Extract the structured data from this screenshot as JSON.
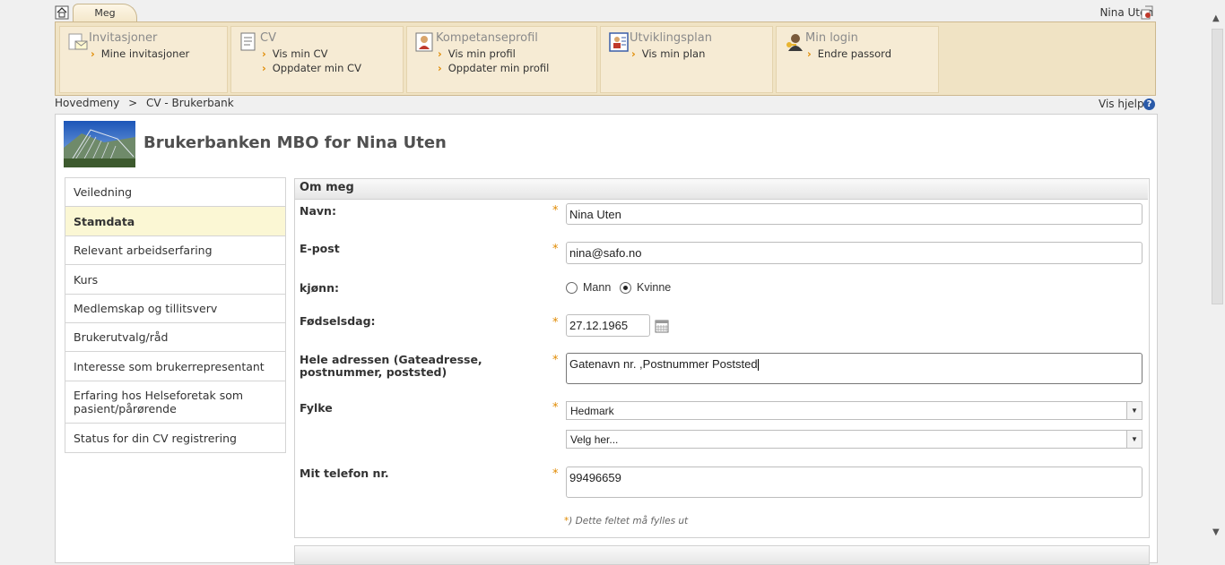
{
  "top": {
    "tab_label": "Meg",
    "user_name": "Nina Uten"
  },
  "menu": [
    {
      "title": "Invitasjoner",
      "links": [
        "Mine invitasjoner"
      ]
    },
    {
      "title": "CV",
      "links": [
        "Vis min CV",
        "Oppdater min CV"
      ]
    },
    {
      "title": "Kompetanseprofil",
      "links": [
        "Vis min profil",
        "Oppdater min profil"
      ]
    },
    {
      "title": "Utviklingsplan",
      "links": [
        "Vis min plan"
      ]
    },
    {
      "title": "Min login",
      "links": [
        "Endre passord"
      ]
    }
  ],
  "breadcrumb": {
    "home": "Hovedmeny",
    "sep": ">",
    "current": "CV - Brukerbank"
  },
  "help": {
    "label": "Vis hjelp",
    "icon": "?"
  },
  "page_title": "Brukerbanken MBO for Nina Uten",
  "nav": [
    "Veiledning",
    "Stamdata",
    "Relevant arbeidserfaring",
    "Kurs",
    "Medlemskap og tillitsverv",
    "Brukerutvalg/råd",
    "Interesse som brukerrepresentant",
    "Erfaring hos Helseforetak som pasient/pårørende",
    "Status for din CV registrering"
  ],
  "nav_active_index": 1,
  "form": {
    "title": "Om meg",
    "name_label": "Navn:",
    "name_value": "Nina Uten",
    "email_label": "E-post",
    "email_value": "nina@safo.no",
    "gender_label": "kjønn:",
    "gender_options": [
      "Mann",
      "Kvinne"
    ],
    "gender_selected": "Kvinne",
    "birthday_label": "Fødselsdag:",
    "birthday_value": "27.12.1965",
    "address_label": "Hele adressen (Gateadresse, postnummer, poststed)",
    "address_value": "Gatenavn nr. ,Postnummer Poststed",
    "county_label": "Fylke",
    "county_value": "Hedmark",
    "municipality_placeholder": "Velg her...",
    "phone_label": "Mit telefon nr.",
    "phone_value": "99496659",
    "required_mark": "*",
    "footnote": ") Dette feltet må fylles ut"
  },
  "colors": {
    "accent_orange": "#e08a00",
    "menu_bg": "#f0e3c4",
    "active_nav": "#fbf7d4"
  }
}
